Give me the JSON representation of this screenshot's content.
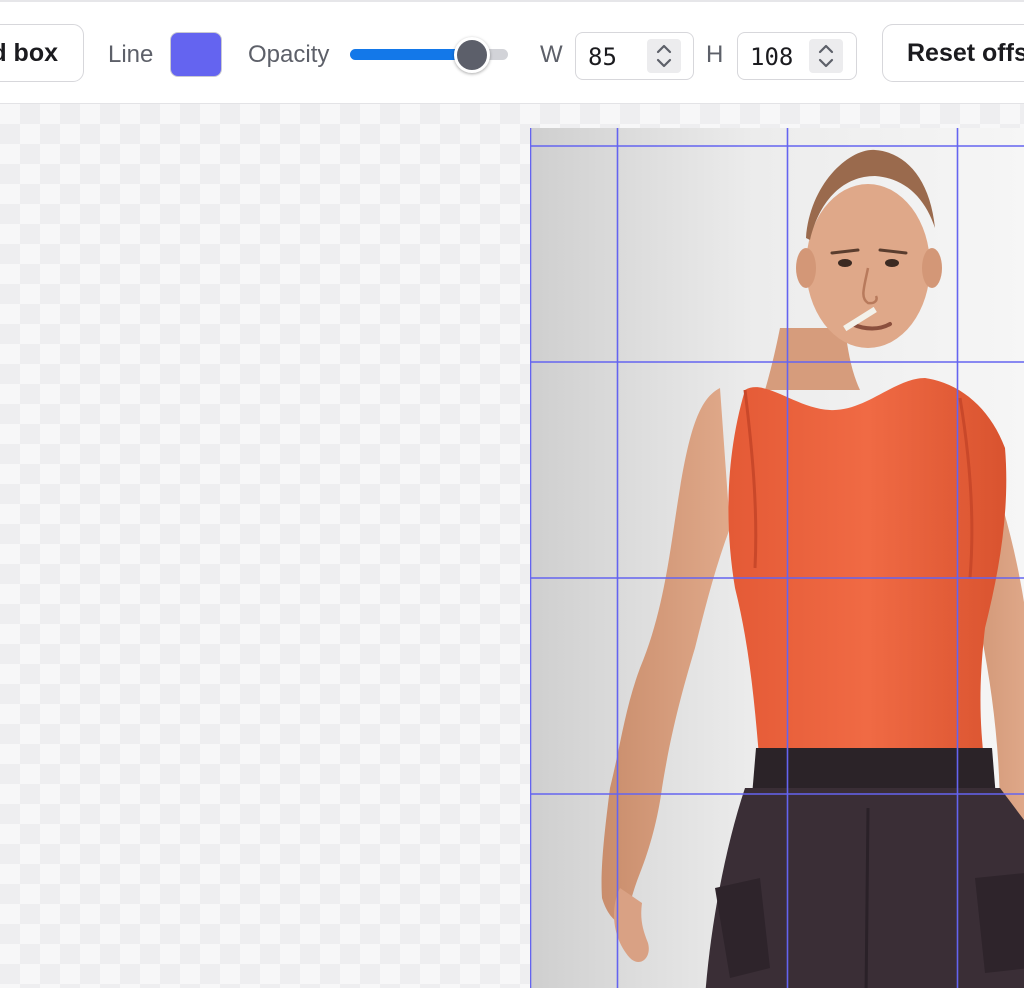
{
  "toolbar": {
    "bbox_button_label": "d box",
    "line_label": "Line",
    "line_color": "#6464f0",
    "opacity_label": "Opacity",
    "opacity_value": 0.85,
    "opacity_fill_color": "#1378e9",
    "width_label": "W",
    "width_value": "85",
    "height_label": "H",
    "height_value": "108",
    "reset_button_label": "Reset offs"
  },
  "canvas": {
    "grid_color": "#6464f0",
    "image_icon": "photo-person-orange-tank-top"
  }
}
